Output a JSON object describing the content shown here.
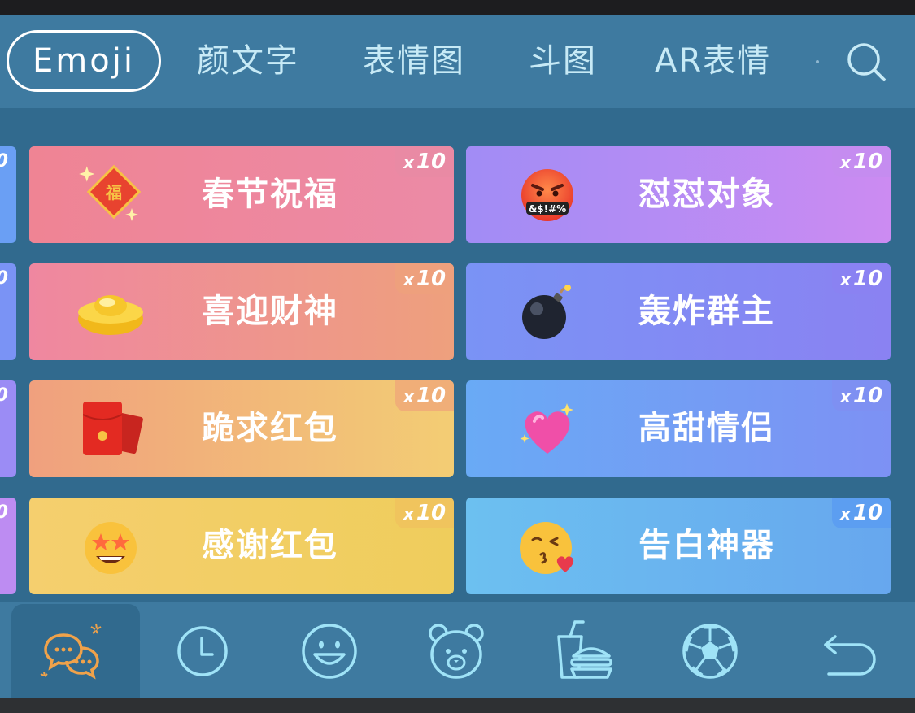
{
  "tabs": {
    "emoji": "Emoji",
    "kaomoji": "颜文字",
    "stickers": "表情图",
    "doutu": "斗图",
    "ar": "AR表情"
  },
  "badge_prefix": "x",
  "cards": [
    {
      "label": "春节祝福",
      "count": "10",
      "icon": "fu-diamond-icon"
    },
    {
      "label": "怼怼对象",
      "count": "10",
      "icon": "cursing-face-icon"
    },
    {
      "label": "喜迎财神",
      "count": "10",
      "icon": "gold-ingot-icon"
    },
    {
      "label": "轰炸群主",
      "count": "10",
      "icon": "bomb-icon"
    },
    {
      "label": "跪求红包",
      "count": "10",
      "icon": "red-envelope-icon"
    },
    {
      "label": "高甜情侣",
      "count": "10",
      "icon": "sparkling-heart-icon"
    },
    {
      "label": "感谢红包",
      "count": "10",
      "icon": "star-struck-icon"
    },
    {
      "label": "告白神器",
      "count": "10",
      "icon": "kissing-heart-icon"
    }
  ],
  "emoji_text": {
    "cursing": "&$!#%"
  },
  "bottom_bar": [
    "chat-bubbles-icon",
    "clock-icon",
    "smiley-icon",
    "bear-icon",
    "food-icon",
    "soccer-ball-icon",
    "back-arrow-icon"
  ],
  "colors": {
    "keyboard_bg": "#316a8e",
    "bar_bg": "#3e7aa0",
    "tab_text": "#c7eaf6",
    "icon_stroke": "#9fe3f7"
  }
}
